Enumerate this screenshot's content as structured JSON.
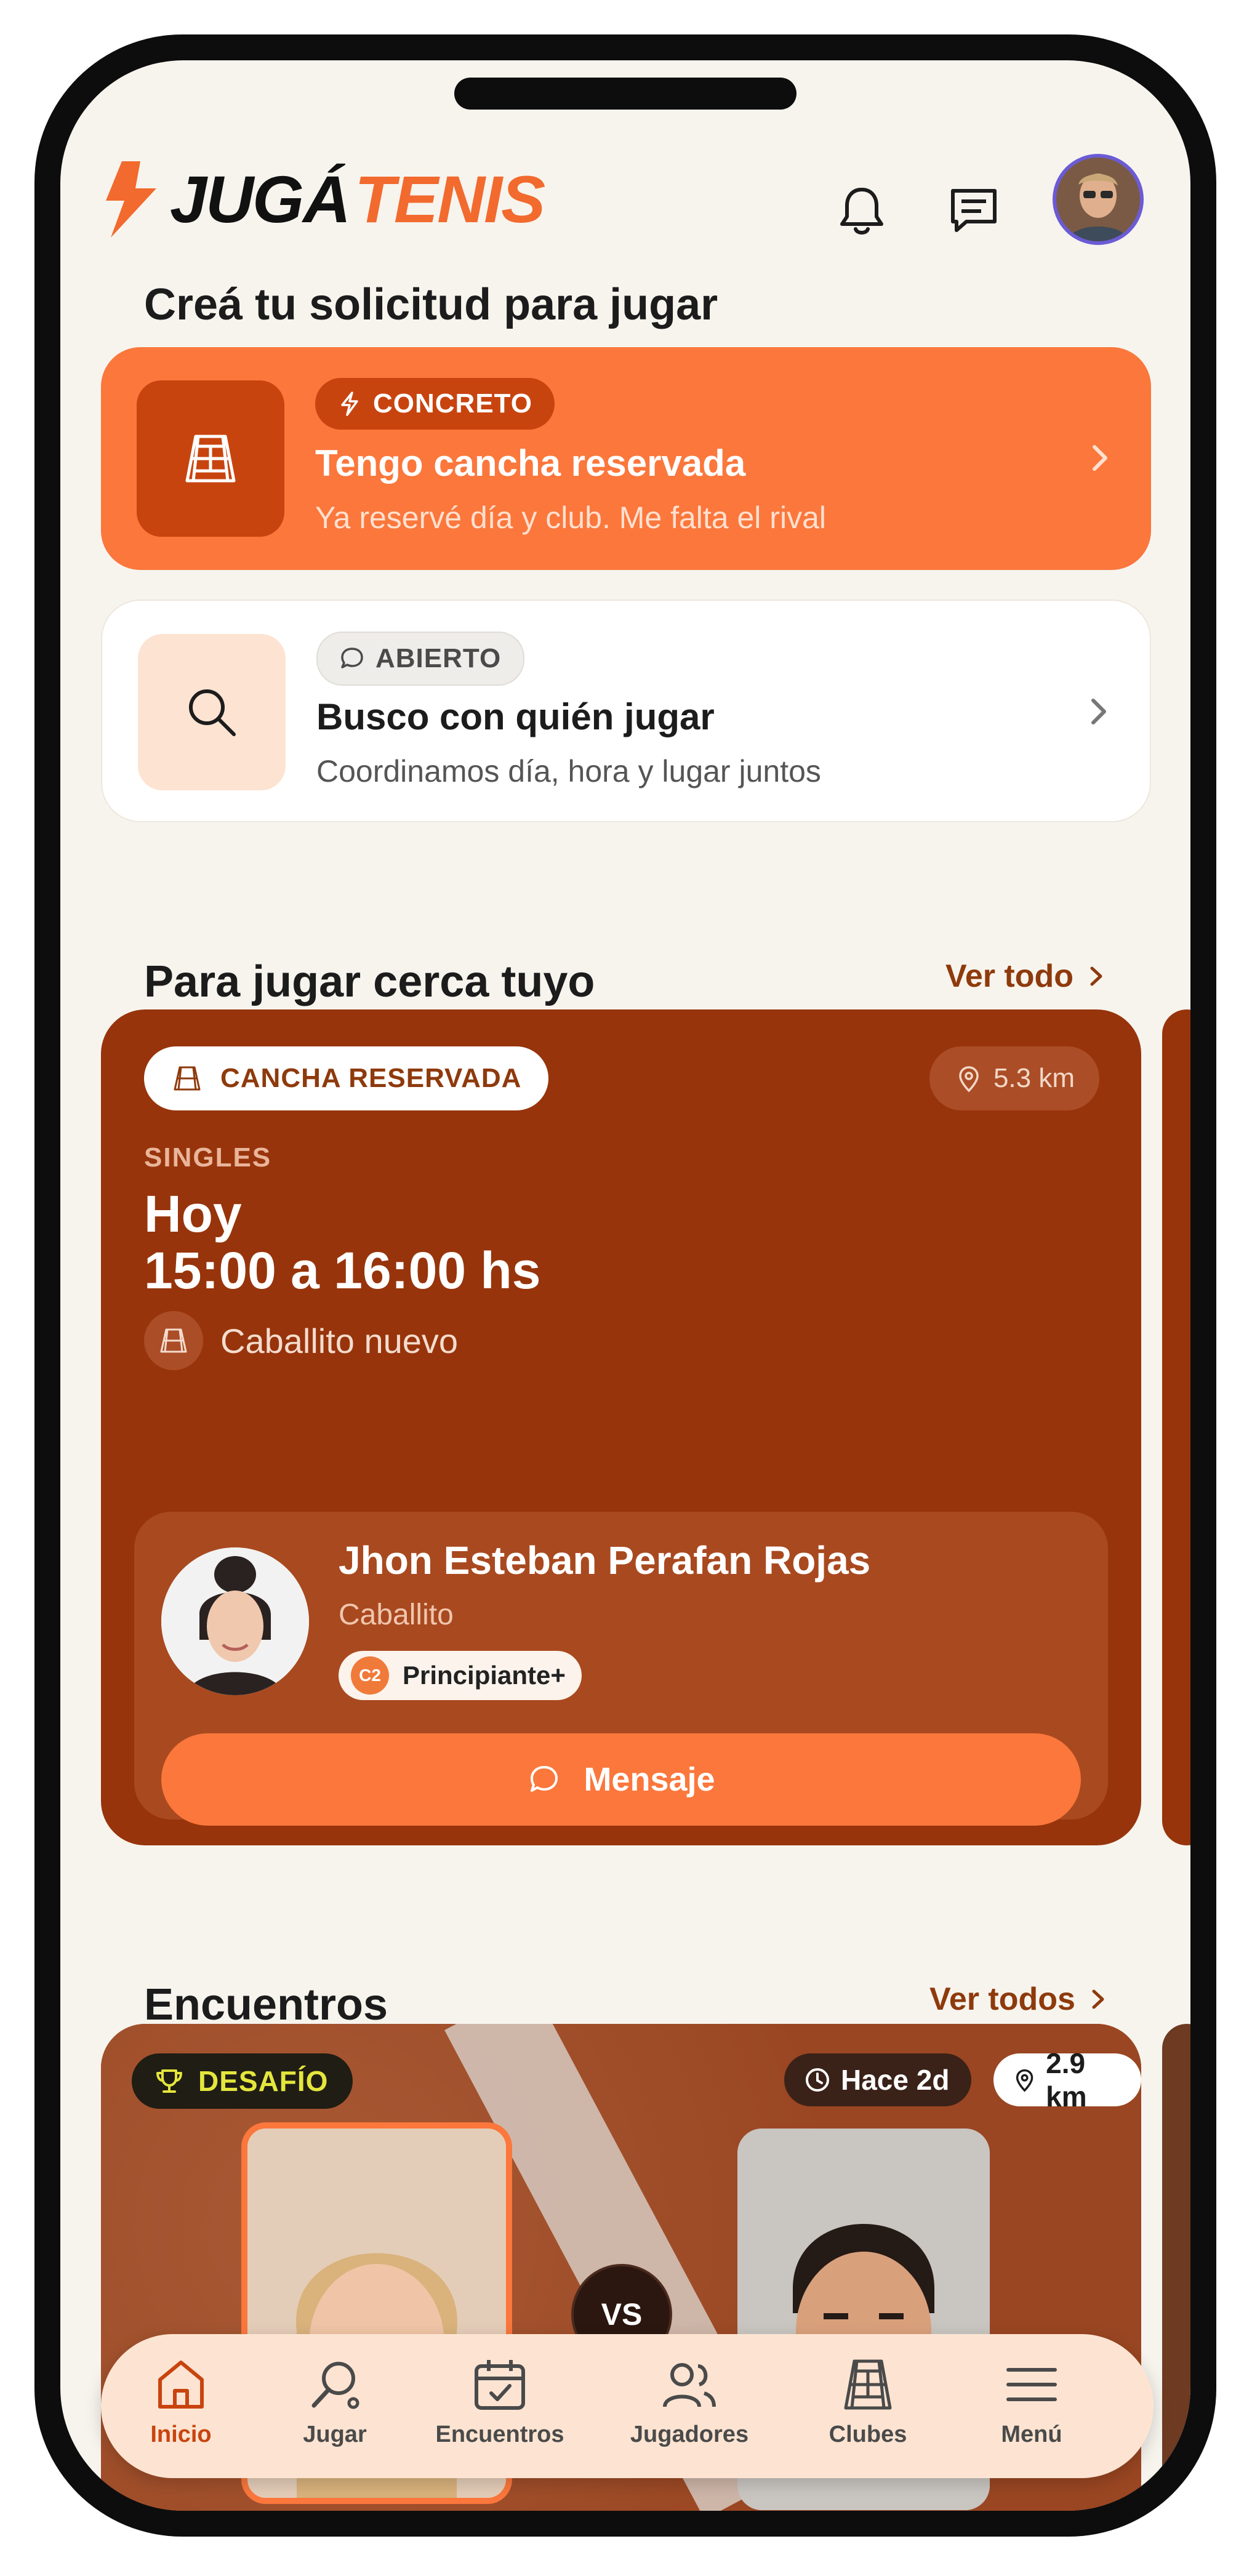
{
  "app": {
    "brand_part1": "JUGÁ",
    "brand_part2": "TENIS"
  },
  "header": {
    "notifications_icon": "bell-icon",
    "messages_icon": "chat-icon"
  },
  "create": {
    "title": "Creá tu solicitud para jugar",
    "concrete": {
      "badge": "CONCRETO",
      "title": "Tengo cancha reservada",
      "subtitle": "Ya reservé día y club. Me falta el rival"
    },
    "open": {
      "badge": "ABIERTO",
      "title": "Busco con quién jugar",
      "subtitle": "Coordinamos día, hora y lugar juntos"
    }
  },
  "nearby": {
    "title": "Para jugar cerca tuyo",
    "see_all": "Ver todo",
    "card": {
      "tag": "CANCHA RESERVADA",
      "distance": "5.3 km",
      "kind": "SINGLES",
      "day": "Hoy",
      "time": "15:00 a 16:00 hs",
      "club": "Caballito nuevo",
      "player": {
        "name": "Jhon Esteban Perafan Rojas",
        "location": "Caballito",
        "level_code": "C2",
        "level": "Principiante+"
      },
      "message_button": "Mensaje"
    }
  },
  "matches": {
    "title": "Encuentros",
    "see_all": "Ver todos",
    "card": {
      "tag": "DESAFÍO",
      "ago": "Hace 2d",
      "distance": "2.9 km",
      "vs": "VS"
    }
  },
  "nav": {
    "items": [
      {
        "label": "Inicio",
        "icon": "home-icon"
      },
      {
        "label": "Jugar",
        "icon": "racket-icon"
      },
      {
        "label": "Encuentros",
        "icon": "calendar-icon"
      },
      {
        "label": "Jugadores",
        "icon": "users-icon"
      },
      {
        "label": "Clubes",
        "icon": "court-icon"
      },
      {
        "label": "Menú",
        "icon": "menu-icon"
      }
    ],
    "active": "Inicio"
  },
  "colors": {
    "accent": "#fb773c",
    "brand_dark": "#97340b",
    "background": "#f7f4ee",
    "nav_bg": "#fde4d2"
  }
}
